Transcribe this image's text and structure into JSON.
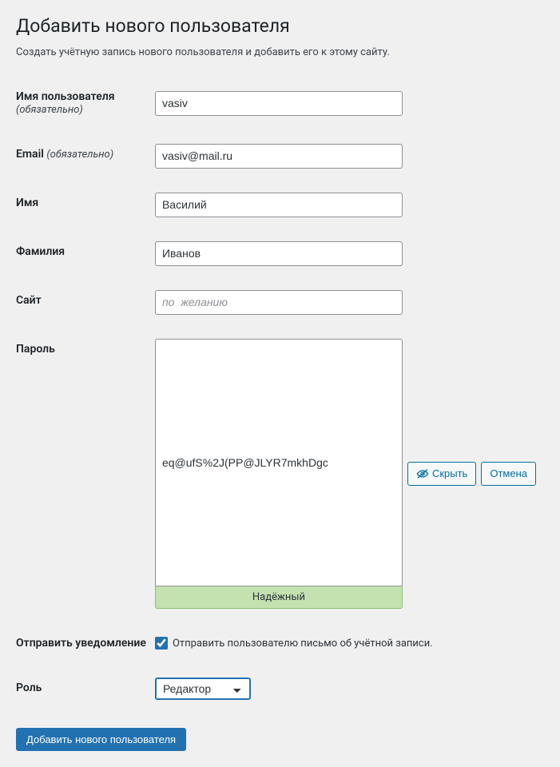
{
  "title": "Добавить нового пользователя",
  "subtitle": "Создать учётную запись нового пользователя и добавить его к этому сайту.",
  "fields": {
    "username": {
      "label": "Имя пользователя",
      "required": "(обязательно)",
      "value": "vasiv"
    },
    "email": {
      "label": "Email",
      "required": "(обязательно)",
      "value": "vasiv@mail.ru"
    },
    "first": {
      "label": "Имя",
      "value": "Василий"
    },
    "last": {
      "label": "Фамилия",
      "value": "Иванов"
    },
    "site": {
      "label": "Сайт",
      "value": "",
      "placeholder": "по  желанию"
    },
    "password": {
      "label": "Пароль",
      "value": "eq@ufS%2J(PP@JLYR7mkhDgc",
      "strength": "Надёжный",
      "hide": "Скрыть",
      "cancel": "Отмена"
    },
    "notify": {
      "label": "Отправить уведомление",
      "text": "Отправить пользователю письмо об учётной записи."
    },
    "role": {
      "label": "Роль",
      "value": "Редактор"
    }
  },
  "submit": "Добавить нового пользователя"
}
